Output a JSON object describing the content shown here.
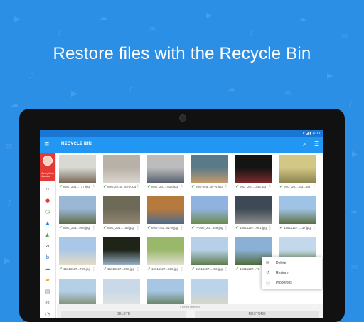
{
  "headline": "Restore files with the Recycle Bin",
  "statusbar": {
    "indicators": "▾ ◢ ▮ 4:17"
  },
  "appbar": {
    "title": "RECYCLE BIN"
  },
  "profile": {
    "name": "Josephine\nJacobs"
  },
  "grid": [
    {
      "label": "IMG_201...717.jpg",
      "icon": "check-circle-icon",
      "colors": [
        "#d9d9d4",
        "#7a6a5a"
      ]
    },
    {
      "label": "IMG-2015...49-V.jpg",
      "icon": "check-circle-icon",
      "colors": [
        "#b8b1a8",
        "#d8d4ce"
      ]
    },
    {
      "label": "IMG_201...024.jpg",
      "icon": "check-circle-icon",
      "colors": [
        "#bcbcbc",
        "#5a6270"
      ]
    },
    {
      "label": "IMG-5c5...dF-V.jpg",
      "icon": "check-circle-icon",
      "colors": [
        "#5a7a8a",
        "#c39a6b"
      ]
    },
    {
      "label": "IMG_201...344.jpg",
      "icon": "check-circle-icon",
      "colors": [
        "#141414",
        "#7a2a2a"
      ]
    },
    {
      "label": "IMG_201...831.jpg",
      "icon": "check-circle-icon",
      "colors": [
        "#d3c785",
        "#8c8550"
      ]
    },
    {
      "label": "IMG_201...956.jpg",
      "icon": "check-circle-icon",
      "colors": [
        "#9ab7d6",
        "#5e6e48"
      ]
    },
    {
      "label": "IMG_201...155.jpg",
      "icon": "check-circle-icon",
      "colors": [
        "#6e6a58",
        "#8f8570"
      ]
    },
    {
      "label": "IMG-c51...51-V.jpg",
      "icon": "check-circle-icon",
      "colors": [
        "#b77a3e",
        "#4d6b8a"
      ]
    },
    {
      "label": "PANO_20...859.jpg",
      "icon": "check-circle-icon",
      "colors": [
        "#8fb3de",
        "#6c8a4e"
      ]
    },
    {
      "label": "15611127...061.jpg",
      "icon": "check-circle-icon",
      "colors": [
        "#3d4a55",
        "#8c8c8c"
      ]
    },
    {
      "label": "15611127...137.jpg",
      "icon": "check-circle-icon",
      "colors": [
        "#9fc3e4",
        "#5c7045"
      ]
    },
    {
      "label": "15611127...759.jpg",
      "icon": "check-circle-icon",
      "colors": [
        "#a9c8e8",
        "#e6dbc5"
      ]
    },
    {
      "label": "15611127...698.jpg",
      "icon": "check-circle-icon",
      "colors": [
        "#1e2418",
        "#9ab2c7"
      ]
    },
    {
      "label": "15611127...926.jpg",
      "icon": "check-circle-icon",
      "colors": [
        "#9ab86a",
        "#e3e0d4"
      ]
    },
    {
      "label": "15611127...496.jpg",
      "icon": "check-circle-icon",
      "colors": [
        "#b7d0e8",
        "#5d7b4a"
      ]
    },
    {
      "label": "15611127...76",
      "icon": "check-circle-icon",
      "colors": [
        "#8ab0d6",
        "#4f6a3a"
      ]
    },
    {
      "label": "",
      "icon": "check-circle-icon",
      "colors": [
        "#c3d8ea",
        "#62803e"
      ]
    },
    {
      "label": "15611127...192.jpg",
      "icon": "check-circle-icon",
      "colors": [
        "#b5cfe6",
        "#7a8a6a"
      ]
    },
    {
      "label": "temp2.jpg",
      "icon": "check-circle-icon",
      "colors": [
        "#c9d9e8",
        "#e4e4e0"
      ]
    },
    {
      "label": "15611127...926.jpg",
      "icon": "check-circle-icon",
      "colors": [
        "#a6c6e4",
        "#607a50"
      ]
    },
    {
      "label": "15611127...278.jpg",
      "icon": "check-circle-icon",
      "colors": [
        "#bcd4ea",
        "#dfd6c0"
      ]
    }
  ],
  "context_menu": [
    {
      "label": "Delete",
      "icon": "trash-icon"
    },
    {
      "label": "Restore",
      "icon": "restore-icon"
    },
    {
      "label": "Properties",
      "icon": "info-icon"
    }
  ],
  "selection": {
    "count_text": "0 items selected",
    "delete_label": "DELETE",
    "restore_label": "RESTORE"
  }
}
